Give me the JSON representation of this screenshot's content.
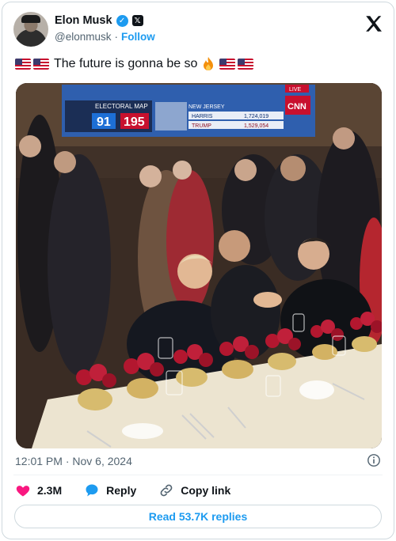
{
  "user": {
    "name": "Elon Musk",
    "handle": "@elonmusk",
    "separator": "·",
    "follow_label": "Follow",
    "verified_icon": "verified-badge-icon",
    "affiliate_icon": "x-affiliate-icon"
  },
  "tweet": {
    "text": "The future is gonna be so",
    "leading_emoji": [
      "us-flag-icon",
      "us-flag-icon"
    ],
    "trailing_emoji": [
      "fire-icon",
      "us-flag-icon",
      "us-flag-icon"
    ]
  },
  "media": {
    "tv_overlay": {
      "title": "ELECTORAL MAP",
      "left_count": "91",
      "right_count": "195",
      "state": "NEW JERSEY",
      "row1_name": "HARRIS",
      "row2_name": "TRUMP",
      "row1_votes": "1,724,019",
      "row2_votes": "1,529,054",
      "network": "CNN",
      "live": "LIVE"
    }
  },
  "meta": {
    "timestamp": "12:01 PM · Nov 6, 2024"
  },
  "actions": {
    "likes_count": "2.3M",
    "reply_label": "Reply",
    "copy_link_label": "Copy link"
  },
  "read_replies_label": "Read 53.7K replies",
  "colors": {
    "accent": "#1d9bf0",
    "like": "#f91880",
    "text_secondary": "#536471",
    "border": "#cfd9de"
  }
}
